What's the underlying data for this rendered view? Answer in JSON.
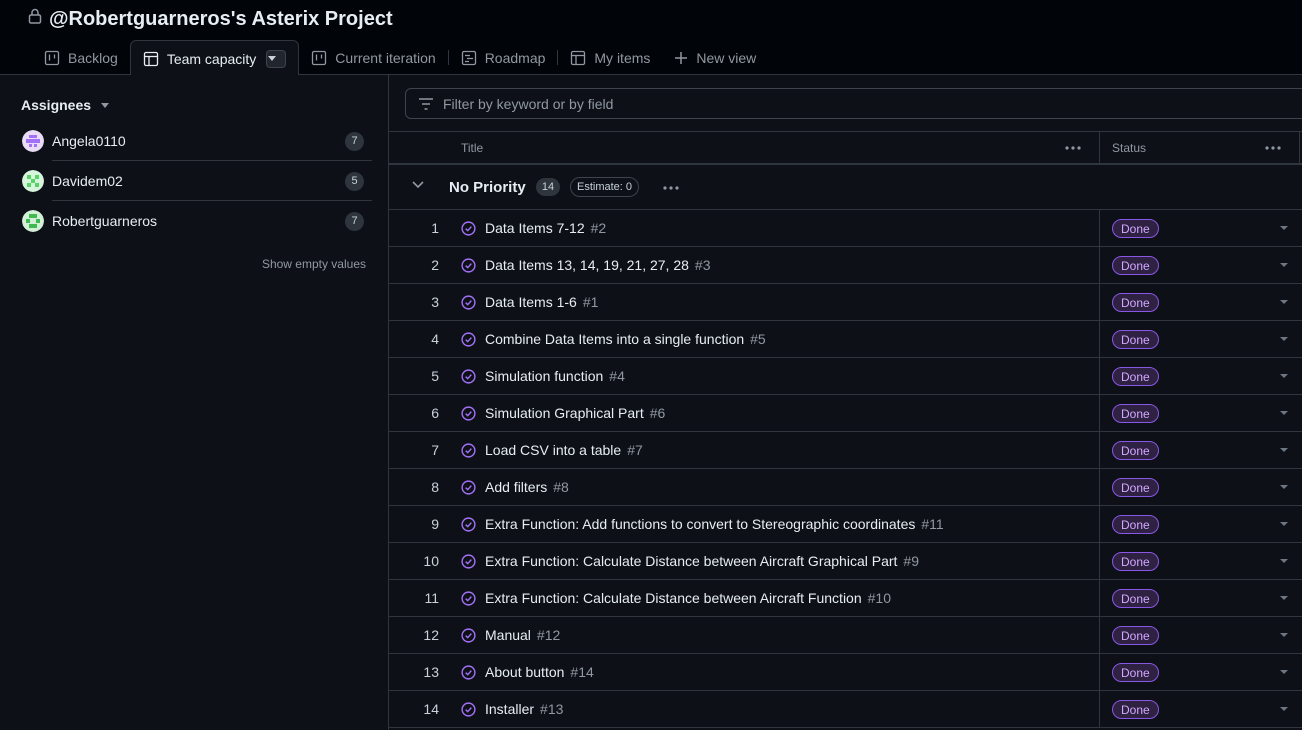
{
  "project": {
    "title": "@Robertguarneros's Asterix Project"
  },
  "tabs": [
    {
      "label": "Backlog",
      "icon": "board-icon"
    },
    {
      "label": "Team capacity",
      "icon": "table-icon",
      "active": true
    },
    {
      "label": "Current iteration",
      "icon": "board-icon"
    },
    {
      "label": "Roadmap",
      "icon": "roadmap-icon"
    },
    {
      "label": "My items",
      "icon": "table-icon"
    }
  ],
  "new_view_label": "New view",
  "sidebar": {
    "heading": "Assignees",
    "assignees": [
      {
        "name": "Angela0110",
        "count": "7",
        "avatar_color": "#a371f7"
      },
      {
        "name": "Davidem02",
        "count": "5",
        "avatar_color": "#56d364"
      },
      {
        "name": "Robertguarneros",
        "count": "7",
        "avatar_color": "#3fb950"
      }
    ],
    "show_empty": "Show empty values"
  },
  "filter": {
    "placeholder": "Filter by keyword or by field"
  },
  "columns": {
    "title": "Title",
    "status": "Status"
  },
  "group": {
    "title": "No Priority",
    "count": "14",
    "estimate": "Estimate: 0"
  },
  "rows": [
    {
      "num": "1",
      "title": "Data Items 7-12",
      "issue": "#2",
      "status": "Done"
    },
    {
      "num": "2",
      "title": "Data Items 13, 14, 19, 21, 27, 28",
      "issue": "#3",
      "status": "Done"
    },
    {
      "num": "3",
      "title": "Data Items 1-6",
      "issue": "#1",
      "status": "Done"
    },
    {
      "num": "4",
      "title": "Combine Data Items into a single function",
      "issue": "#5",
      "status": "Done"
    },
    {
      "num": "5",
      "title": "Simulation function",
      "issue": "#4",
      "status": "Done"
    },
    {
      "num": "6",
      "title": "Simulation Graphical Part",
      "issue": "#6",
      "status": "Done"
    },
    {
      "num": "7",
      "title": "Load CSV into a table",
      "issue": "#7",
      "status": "Done"
    },
    {
      "num": "8",
      "title": "Add filters",
      "issue": "#8",
      "status": "Done"
    },
    {
      "num": "9",
      "title": "Extra Function: Add functions to convert to Stereographic coordinates",
      "issue": "#11",
      "status": "Done"
    },
    {
      "num": "10",
      "title": "Extra Function: Calculate Distance between Aircraft Graphical Part",
      "issue": "#9",
      "status": "Done"
    },
    {
      "num": "11",
      "title": "Extra Function: Calculate Distance between Aircraft Function",
      "issue": "#10",
      "status": "Done"
    },
    {
      "num": "12",
      "title": "Manual",
      "issue": "#12",
      "status": "Done"
    },
    {
      "num": "13",
      "title": "About button",
      "issue": "#14",
      "status": "Done"
    },
    {
      "num": "14",
      "title": "Installer",
      "issue": "#13",
      "status": "Done"
    }
  ],
  "colors": {
    "background": "#0d1117",
    "border": "#30363d",
    "done_purple": "#a371f7"
  }
}
